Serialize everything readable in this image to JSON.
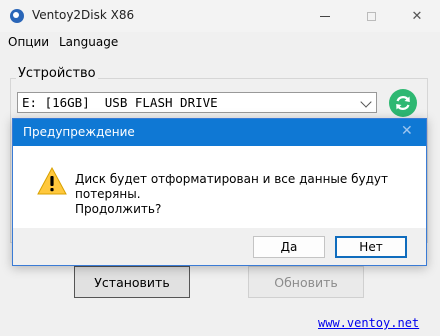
{
  "window": {
    "title": "Ventoy2Disk  X86",
    "icon": "ventoy-app-icon",
    "controls": {
      "minimize": "minimize-icon",
      "maximize": "maximize-icon",
      "close": "✕"
    }
  },
  "menu": {
    "options_label": "Опции",
    "language_label": "Language"
  },
  "device": {
    "group_label": "Устройство",
    "selected": "E: [16GB]  USB FLASH DRIVE",
    "refresh_icon": "refresh-icon",
    "refresh_color": "#2eb872"
  },
  "actions": {
    "install_label": "Установить",
    "update_label": "Обновить",
    "update_disabled": true
  },
  "footer": {
    "link_text": "www.ventoy.net"
  },
  "dialog": {
    "title": "Предупреждение",
    "close_glyph": "✕",
    "icon": "warning-icon",
    "message_line1": "Диск будет отформатирован и все данные будут потеряны.",
    "message_line2": "Продолжить?",
    "yes_label": "Да",
    "no_label": "Нет",
    "accent_color": "#0f78d4"
  }
}
